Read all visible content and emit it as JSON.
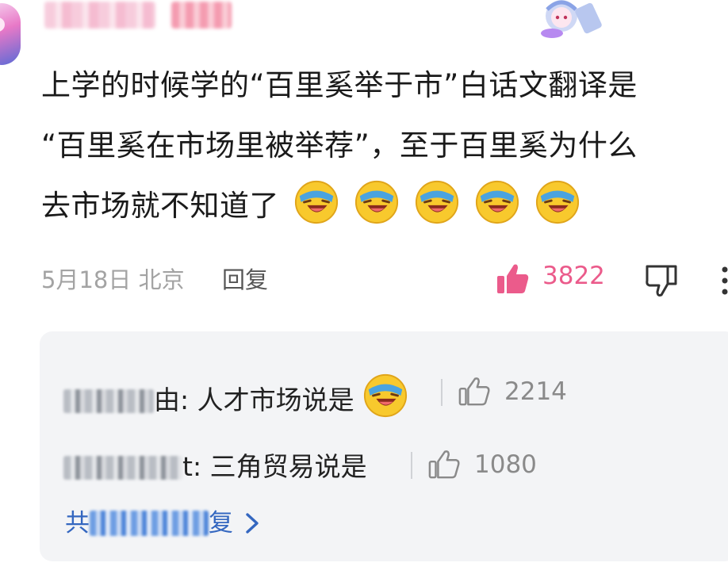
{
  "comment": {
    "line1": "上学的时候学的“百里奚举于市”白话文翻译是",
    "line2": "“百里奚在市场里被举荐”，至于百里奚为什么",
    "line3": "去市场就不知道了",
    "emojis": [
      "laughing-cry-emoji",
      "laughing-cry-emoji",
      "laughing-cry-emoji",
      "laughing-cry-emoji",
      "laughing-cry-emoji"
    ],
    "date_location": "5月18日 北京",
    "reply_label": "回复",
    "like_count": "3822",
    "accent_color": "#eb5b8b"
  },
  "replies": [
    {
      "name_tail": "由:",
      "text": "人才市场说是",
      "like_count": "2214",
      "has_emoji": true
    },
    {
      "name_tail": "t:",
      "text": "三角贸易说是",
      "like_count": "1080",
      "has_emoji": false
    }
  ],
  "more_replies": {
    "prefix": "共",
    "suffix": "复"
  }
}
